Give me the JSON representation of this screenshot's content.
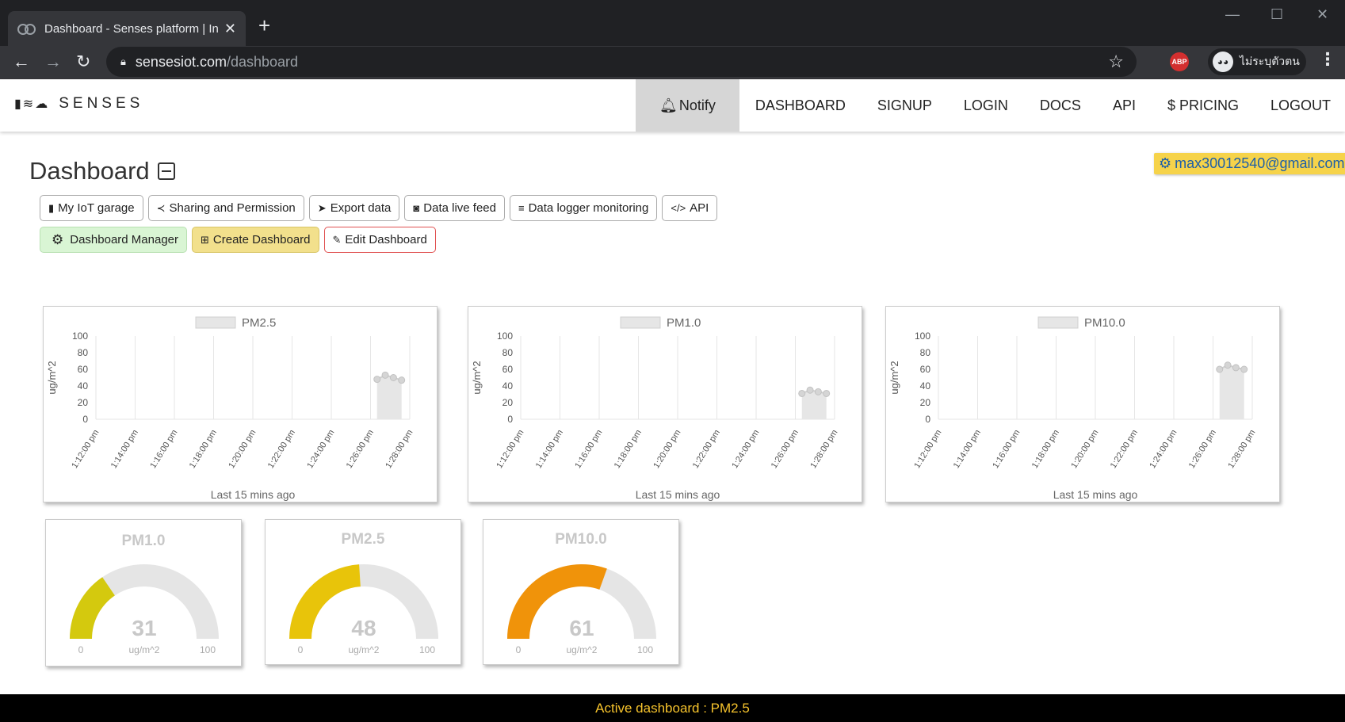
{
  "browser": {
    "tab_title": "Dashboard - Senses platform | In",
    "url_host": "sensesiot.com",
    "url_path": "/dashboard",
    "abp_label": "ABP",
    "profile_name": "ไม่ระบุตัวตน"
  },
  "nav": {
    "brand": "SENSES",
    "items": [
      "Notify",
      "DASHBOARD",
      "SIGNUP",
      "LOGIN",
      "DOCS",
      "API",
      "$ PRICING",
      "LOGOUT"
    ]
  },
  "dashboard": {
    "title": "Dashboard",
    "user_email": "max30012540@gmail.com",
    "buttons_row1": [
      "My IoT garage",
      "Sharing and Permission",
      "Export data",
      "Data live feed",
      "Data logger monitoring",
      "API"
    ],
    "buttons_row2": [
      "Dashboard Manager",
      "Create Dashboard",
      "Edit Dashboard"
    ]
  },
  "chart_data": [
    {
      "type": "area",
      "legend": "PM2.5",
      "ylabel": "ug/m^2",
      "xlabel": "Last 15 mins ago",
      "ylim": [
        0,
        100
      ],
      "yticks": [
        100,
        80,
        60,
        40,
        20,
        0
      ],
      "xticks": [
        "1:12:00 pm",
        "1:14:00 pm",
        "1:16:00 pm",
        "1:18:00 pm",
        "1:20:00 pm",
        "1:22:00 pm",
        "1:24:00 pm",
        "1:26:00 pm",
        "1:28:00 pm"
      ],
      "x": [
        "1:26:20 pm",
        "1:26:45 pm",
        "1:27:10 pm",
        "1:27:35 pm"
      ],
      "values": [
        48,
        53,
        50,
        47
      ]
    },
    {
      "type": "area",
      "legend": "PM1.0",
      "ylabel": "ug/m^2",
      "xlabel": "Last 15 mins ago",
      "ylim": [
        0,
        100
      ],
      "yticks": [
        100,
        80,
        60,
        40,
        20,
        0
      ],
      "xticks": [
        "1:12:00 pm",
        "1:14:00 pm",
        "1:16:00 pm",
        "1:18:00 pm",
        "1:20:00 pm",
        "1:22:00 pm",
        "1:24:00 pm",
        "1:26:00 pm",
        "1:28:00 pm"
      ],
      "x": [
        "1:26:20 pm",
        "1:26:45 pm",
        "1:27:10 pm",
        "1:27:35 pm"
      ],
      "values": [
        31,
        35,
        33,
        31
      ]
    },
    {
      "type": "area",
      "legend": "PM10.0",
      "ylabel": "ug/m^2",
      "xlabel": "Last 15 mins ago",
      "ylim": [
        0,
        100
      ],
      "yticks": [
        100,
        80,
        60,
        40,
        20,
        0
      ],
      "xticks": [
        "1:12:00 pm",
        "1:14:00 pm",
        "1:16:00 pm",
        "1:18:00 pm",
        "1:20:00 pm",
        "1:22:00 pm",
        "1:24:00 pm",
        "1:26:00 pm",
        "1:28:00 pm"
      ],
      "x": [
        "1:26:20 pm",
        "1:26:45 pm",
        "1:27:10 pm",
        "1:27:35 pm"
      ],
      "values": [
        60,
        65,
        62,
        60
      ]
    }
  ],
  "gauges": [
    {
      "title": "PM1.0",
      "value": 31,
      "unit": "ug/m^2",
      "min": 0,
      "max": 100,
      "color": "#d4c90e"
    },
    {
      "title": "PM2.5",
      "value": 48,
      "unit": "ug/m^2",
      "min": 0,
      "max": 100,
      "color": "#e8c40a"
    },
    {
      "title": "PM10.0",
      "value": 61,
      "unit": "ug/m^2",
      "min": 0,
      "max": 100,
      "color": "#f0930a"
    }
  ],
  "footer": {
    "text": "Active dashboard : PM2.5"
  },
  "colors": {
    "accent_yellow": "#f6d34a",
    "footer_text": "#f6c32c",
    "chart_fill": "#e6e6e6"
  }
}
